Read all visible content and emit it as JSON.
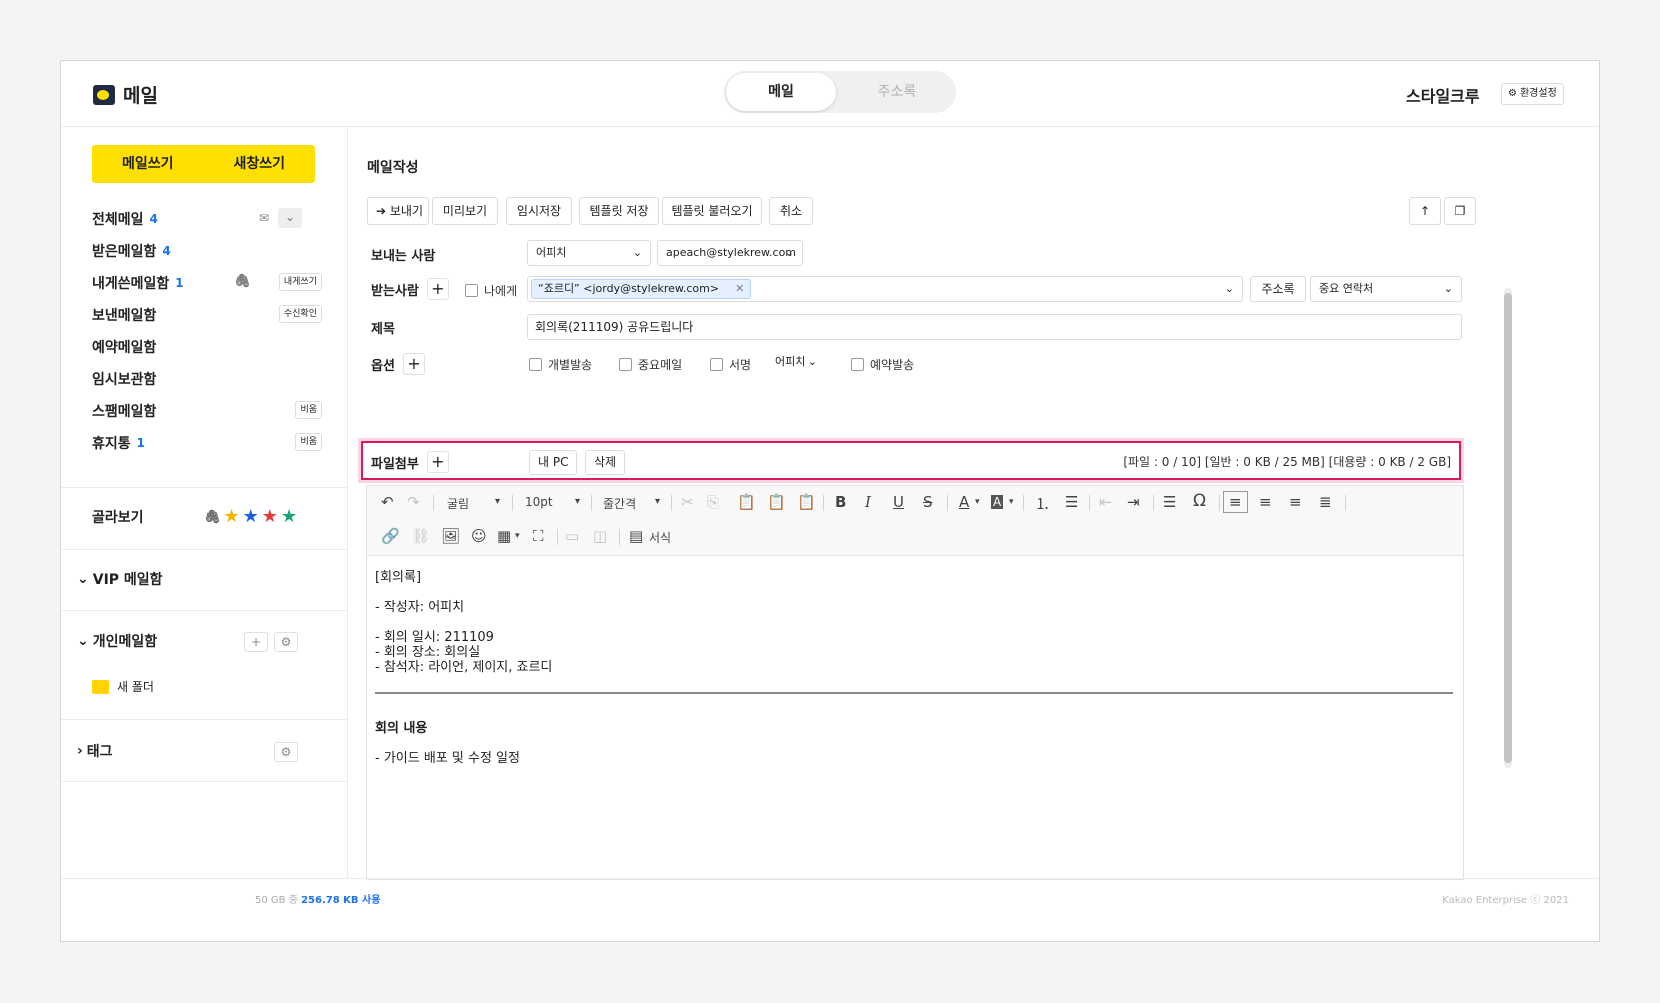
{
  "app": {
    "title": "메일",
    "brand": "스타일크루",
    "settings_label": "환경설정"
  },
  "tabs": [
    {
      "label": "메일",
      "active": true
    },
    {
      "label": "주소록",
      "active": false
    }
  ],
  "sidebar": {
    "write_label": "메일쓰기",
    "new_window_label": "새창쓰기",
    "mailboxes": [
      {
        "label": "전체메일",
        "count": "4"
      },
      {
        "label": "받은메일함",
        "count": "4"
      },
      {
        "label": "내게쓴메일함",
        "count": "1",
        "tag": "내게쓰기"
      },
      {
        "label": "보낸메일함",
        "tag": "수신확인"
      },
      {
        "label": "예약메일함"
      },
      {
        "label": "임시보관함"
      },
      {
        "label": "스팸메일함",
        "tag": "비움"
      },
      {
        "label": "휴지통",
        "count": "1",
        "tag": "비움"
      }
    ],
    "filter_label": "골라보기",
    "star_colors": [
      "#f5b400",
      "#1f5fe0",
      "#e53935",
      "#1aa37a"
    ],
    "vip_label": "VIP 메일함",
    "personal_label": "개인메일함",
    "new_folder_label": "새 폴더",
    "tags_label": "태그"
  },
  "compose": {
    "heading": "메일작성",
    "toolbar": {
      "send": "보내기",
      "preview": "미리보기",
      "draft": "임시저장",
      "save_template": "템플릿 저장",
      "load_template": "템플릿 불러오기",
      "cancel": "취소"
    },
    "from_label": "보내는 사람",
    "from_name": "어피치",
    "from_email": "apeach@stylekrew.com",
    "to_label": "받는사람",
    "to_self_label": "나에게",
    "recipient": "“죠르디” <jordy@stylekrew.com>",
    "addressbook_label": "주소록",
    "contacts_select": "중요 연락처",
    "subject_label": "제목",
    "subject_value": "회의록(211109) 공유드립니다",
    "options_label": "옵션",
    "opt_individual": "개별발송",
    "opt_important": "중요메일",
    "opt_signature": "서명",
    "signature_select": "어피치",
    "opt_scheduled": "예약발송",
    "attach_label": "파일첨부",
    "my_pc_label": "내 PC",
    "delete_label": "삭제",
    "attach_quota": "[파일 : 0 / 10] [일반 : 0 KB / 25 MB] [대용량 : 0 KB / 2 GB]"
  },
  "editor": {
    "font": "굴림",
    "size": "10pt",
    "line_height": "줄간격",
    "format_label": "서식",
    "body": {
      "title": "[회의록]",
      "author": "- 작성자: 어피치",
      "date": "- 회의 일시: 211109",
      "place": "- 회의 장소: 회의실",
      "attendees": "- 참석자: 라이언, 제이지, 죠르디",
      "section": "회의 내용",
      "item": "- 가이드 배포 및 수정 일정"
    }
  },
  "footer": {
    "usage_prefix": "50 GB 중",
    "usage_value": "256.78 KB 사용",
    "copyright": "Kakao Enterprise ⓒ 2021"
  }
}
